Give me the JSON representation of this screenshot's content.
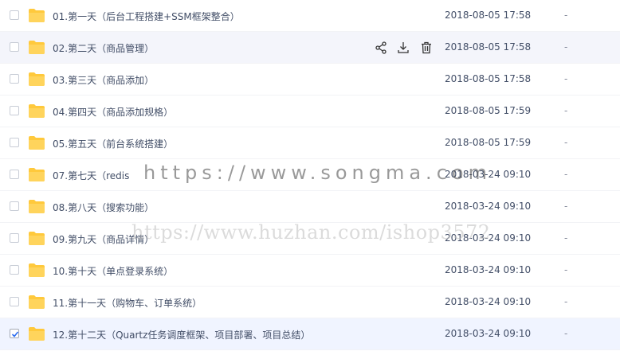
{
  "files": [
    {
      "name": "01.第一天（后台工程搭建+SSM框架整合）",
      "date": "2018-08-05 17:58",
      "size": "-",
      "checked": false,
      "state": "normal"
    },
    {
      "name": "02.第二天（商品管理）",
      "date": "2018-08-05 17:58",
      "size": "-",
      "checked": false,
      "state": "hover"
    },
    {
      "name": "03.第三天（商品添加）",
      "date": "2018-08-05 17:58",
      "size": "-",
      "checked": false,
      "state": "normal"
    },
    {
      "name": "04.第四天（商品添加规格）",
      "date": "2018-08-05 17:59",
      "size": "-",
      "checked": false,
      "state": "normal"
    },
    {
      "name": "05.第五天（前台系统搭建）",
      "date": "2018-08-05 17:59",
      "size": "-",
      "checked": false,
      "state": "normal"
    },
    {
      "name": "07.第七天（redis",
      "date": "2018-03-24 09:10",
      "size": "-",
      "checked": false,
      "state": "normal"
    },
    {
      "name": "08.第八天（搜索功能）",
      "date": "2018-03-24 09:10",
      "size": "-",
      "checked": false,
      "state": "normal"
    },
    {
      "name": "09.第九天（商品详情）",
      "date": "2018-03-24 09:10",
      "size": "-",
      "checked": false,
      "state": "normal"
    },
    {
      "name": "10.第十天（单点登录系统）",
      "date": "2018-03-24 09:10",
      "size": "-",
      "checked": false,
      "state": "normal"
    },
    {
      "name": "11.第十一天（购物车、订单系统）",
      "date": "2018-03-24 09:10",
      "size": "-",
      "checked": false,
      "state": "normal"
    },
    {
      "name": "12.第十二天（Quartz任务调度框架、项目部署、项目总结）",
      "date": "2018-03-24 09:10",
      "size": "-",
      "checked": true,
      "state": "selected"
    }
  ],
  "row_actions": [
    "share-icon",
    "download-icon",
    "delete-icon"
  ],
  "watermarks": {
    "primary": "https://www.songma.com",
    "secondary": "https://www.huzhan.com/ishop3572"
  },
  "colors": {
    "folder": "#ffc93c",
    "hover_row": "#f4f5fb",
    "selected_row": "#f0f4ff",
    "text": "#424e67"
  }
}
